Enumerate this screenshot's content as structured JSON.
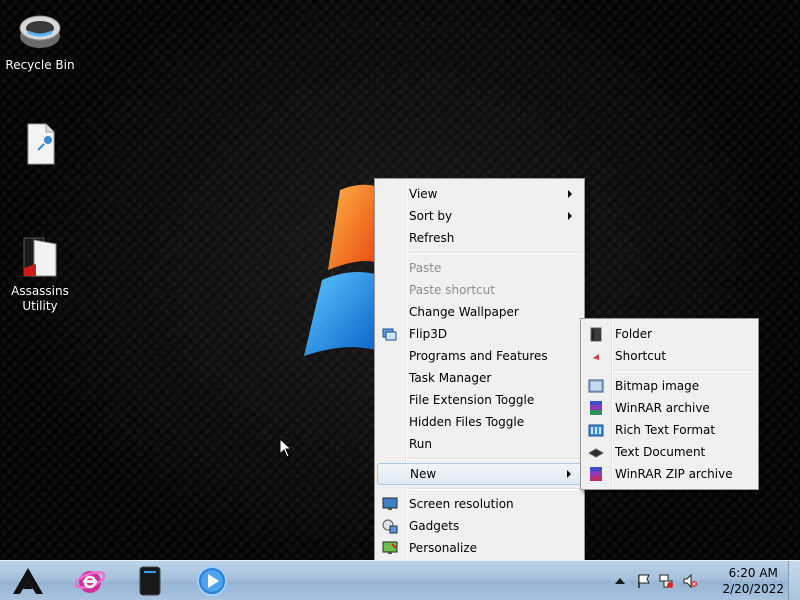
{
  "desktop": {
    "icons": [
      {
        "label": "Recycle Bin",
        "icon": "recycle-bin-icon"
      },
      {
        "label": "",
        "icon": "shortcut-file-icon"
      },
      {
        "label": "Assassins Utility",
        "icon": "assassins-utility-folder-icon"
      }
    ]
  },
  "context_menu": {
    "items": [
      {
        "label": "View",
        "submenu": true
      },
      {
        "label": "Sort by",
        "submenu": true
      },
      {
        "label": "Refresh"
      },
      {
        "label": "Paste",
        "disabled": true
      },
      {
        "label": "Paste shortcut",
        "disabled": true
      },
      {
        "label": "Change Wallpaper"
      },
      {
        "label": "Flip3D",
        "icon": "flip3d-icon"
      },
      {
        "label": "Programs and Features"
      },
      {
        "label": "Task Manager"
      },
      {
        "label": "File Extension Toggle"
      },
      {
        "label": "Hidden Files Toggle"
      },
      {
        "label": "Run"
      },
      {
        "label": "New",
        "submenu": true,
        "highlighted": true
      },
      {
        "label": "Screen resolution",
        "icon": "monitor-icon"
      },
      {
        "label": "Gadgets",
        "icon": "gadgets-icon"
      },
      {
        "label": "Personalize",
        "icon": "personalize-icon"
      }
    ]
  },
  "new_submenu": {
    "items": [
      {
        "label": "Folder",
        "icon": "folder-icon"
      },
      {
        "label": "Shortcut",
        "icon": "shortcut-icon"
      },
      {
        "label": "Bitmap image",
        "icon": "bitmap-icon"
      },
      {
        "label": "WinRAR archive",
        "icon": "winrar-icon"
      },
      {
        "label": "Rich Text Format",
        "icon": "rtf-icon"
      },
      {
        "label": "Text Document",
        "icon": "text-document-icon"
      },
      {
        "label": "WinRAR ZIP archive",
        "icon": "winrar-zip-icon"
      }
    ]
  },
  "taskbar": {
    "pinned": [
      "start-logo-icon",
      "internet-explorer-icon",
      "drive-icon",
      "media-player-icon"
    ],
    "tray": [
      "show-hidden-icons-icon",
      "action-center-flag-icon",
      "network-icon",
      "volume-muted-icon"
    ],
    "time": "6:20 AM",
    "date": "2/20/2022"
  }
}
